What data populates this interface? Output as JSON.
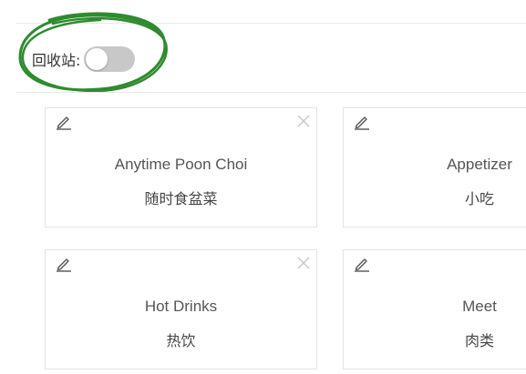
{
  "toolbar": {
    "recycle_label": "回收站:",
    "recycle_toggle_on": false
  },
  "colors": {
    "annotation_circle": "#2e8b2e",
    "toggle_off": "#c8c8c8",
    "card_border": "#e3e3e3"
  },
  "cards": [
    {
      "name": "Anytime Poon Choi",
      "name_zh": "随时食盆菜",
      "edit_icon": "pencil-icon",
      "close_icon": "close-icon"
    },
    {
      "name": "Appetizer",
      "name_zh": "小吃",
      "edit_icon": "pencil-icon"
    },
    {
      "name": "Hot Drinks",
      "name_zh": "热饮",
      "edit_icon": "pencil-icon",
      "close_icon": "close-icon"
    },
    {
      "name": "Meet",
      "name_zh": "肉类",
      "edit_icon": "pencil-icon"
    }
  ]
}
